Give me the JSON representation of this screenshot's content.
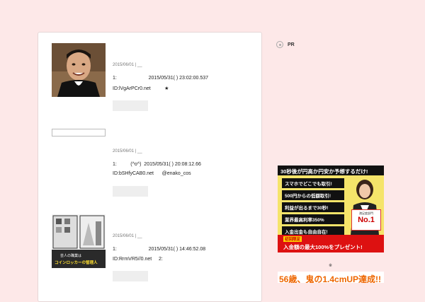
{
  "posts": [
    {
      "date": "2015/06/01 | __",
      "line1": "1:                       2015/05/31( ) 23:02:00.537",
      "line2": "ID:lVgArPCr0.net          ★"
    },
    {
      "date": "2015/06/01 | __",
      "line1": "1:          (^o^)  2015/05/31( ) 20:08:12.66",
      "line2": "ID:bSHfyCAB0.net      @enako_cos"
    },
    {
      "date": "2015/06/01 | __",
      "line1": "1:                       2015/05/31( ) 14:46:52.08",
      "line2": "ID:RrmVR5//0.net     2:"
    }
  ],
  "sidebar": {
    "pr_label": "PR",
    "ad_note": "※"
  },
  "ad1": {
    "headline": "30秒後が円高か円安か予想するだけ!",
    "features": [
      "スマホでどこでも取引!",
      "500円からの低額取引!",
      "利益が出るまで30秒!",
      "業界最高利率350%",
      "入金出金も自由自在!"
    ],
    "badge_top": "満足度部門",
    "badge_main": "No.1",
    "promo_tag": "初回限定",
    "promo": "入金額の最大100%をプレゼント!"
  },
  "ad2": {
    "text": "56歳、鬼の1.4cmUP達成!!"
  },
  "thumb3": {
    "caption1": "芸人の職業は",
    "caption2": "コインロッカーの管理人"
  }
}
